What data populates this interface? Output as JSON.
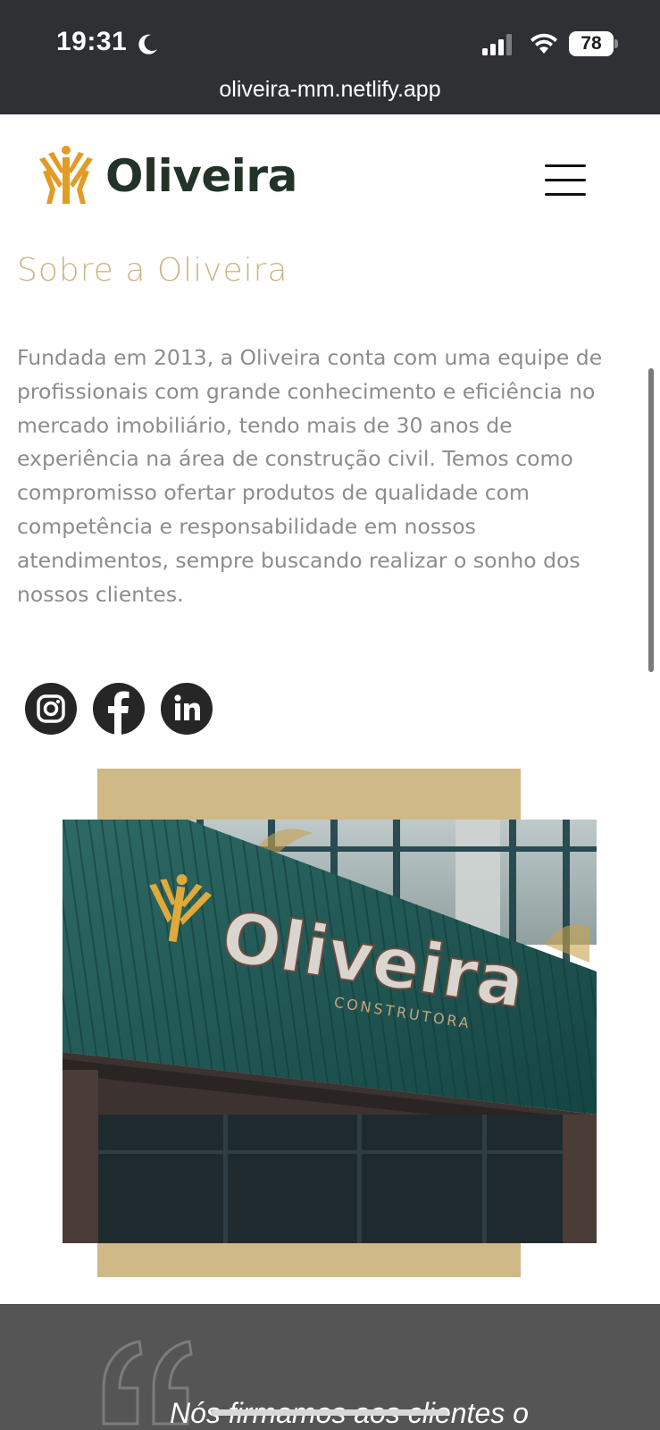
{
  "status_bar": {
    "time": "19:31",
    "battery": "78",
    "icons": [
      "moon-icon",
      "signal-icon",
      "wifi-icon",
      "battery-icon"
    ]
  },
  "browser": {
    "url": "oliveira-mm.netlify.app"
  },
  "header": {
    "logo_text": "Oliveira",
    "menu_icon": "hamburger-menu-icon"
  },
  "about": {
    "title": "Sobre a Oliveira",
    "lines": [
      "Fundada em 2013, a Oliveira conta com uma equipe de",
      "profissionais com grande conhecimento e eficiência no",
      "mercado imobiliário, tendo mais de 30 anos de",
      "experiência na área de construção civil. Temos como",
      "compromisso ofertar produtos de qualidade com",
      "competência e responsabilidade em nossos",
      "atendimentos, sempre buscando realizar o sonho dos",
      "nossos clientes."
    ]
  },
  "social": {
    "items": [
      "instagram-icon",
      "facebook-icon",
      "linkedin-icon"
    ]
  },
  "photo": {
    "sign_name": "Oliveira",
    "sign_subtitle": "CONSTRUTORA"
  },
  "testimonial": {
    "text": "Nós firmamos aos clientes o"
  },
  "colors": {
    "gold": "#cfb986",
    "title_gold": "#cdb585",
    "dark_green": "#223328",
    "logo_orange": "#e39b25",
    "topbar": "#2e3033",
    "quote_bg": "#555555"
  }
}
